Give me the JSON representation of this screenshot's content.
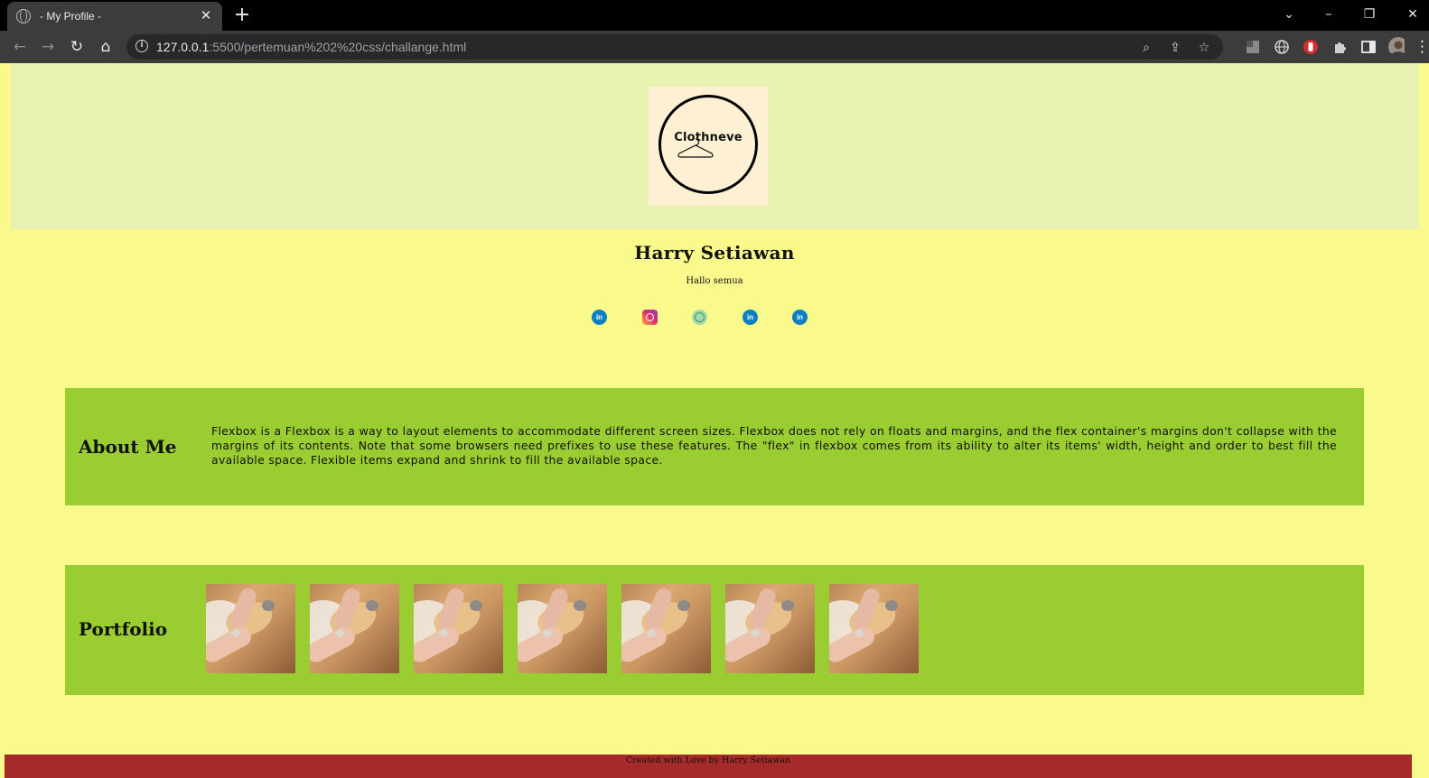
{
  "browser": {
    "tab_title": "- My Profile -",
    "tab_close": "✕",
    "new_tab": "+",
    "url_host": "127.0.0.1",
    "url_rest": ":5500/pertemuan%202%20css/challange.html",
    "icons": [
      "globe-icon",
      "close-icon",
      "plus-icon",
      "back-icon",
      "forward-icon",
      "reload-icon",
      "home-icon",
      "info-icon",
      "zoom-icon",
      "share-icon",
      "bookmark-star-icon",
      "extension-icon",
      "puzzle-icon",
      "side-panel-icon",
      "profile-avatar",
      "menu-icon"
    ]
  },
  "header": {
    "logo_text": "Clothneve"
  },
  "profile": {
    "name": "Harry Setiawan",
    "tagline": "Hallo semua",
    "socials": [
      {
        "icon": "linkedin-icon",
        "glyph": "in"
      },
      {
        "icon": "instagram-icon",
        "glyph": ""
      },
      {
        "icon": "whatsapp-icon",
        "glyph": ""
      },
      {
        "icon": "linkedin-icon",
        "glyph": "in"
      },
      {
        "icon": "linkedin-icon",
        "glyph": "in"
      }
    ]
  },
  "about": {
    "title": "About Me",
    "text": "Flexbox is a Flexbox is a way to layout elements to accommodate different screen sizes. Flexbox does not rely on floats and margins, and the flex container's margins don't collapse with the margins of its contents. Note that some browsers need prefixes to use these features. The \"flex\" in flexbox comes from its ability to alter its items' width, height and order to best fill the available space. Flexible items expand and shrink to fill the available space."
  },
  "portfolio": {
    "title": "Portfolio",
    "image_count": 7
  },
  "footer": {
    "text": "Created with Love by Harry Setiawan"
  },
  "colors": {
    "page_bg": "#fafa8c",
    "header_bg": "#e8f2b0",
    "section_bg": "#9acd32",
    "footer_bg": "#a52a2a"
  }
}
